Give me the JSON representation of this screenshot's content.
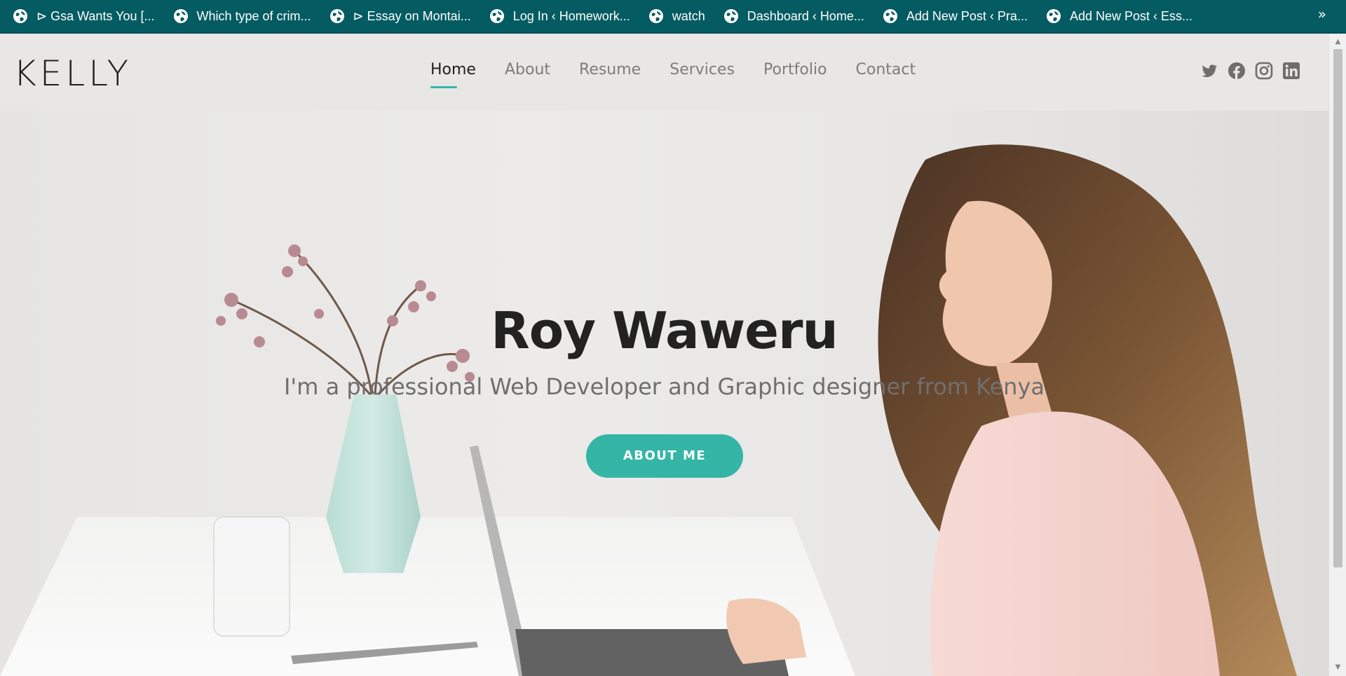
{
  "bookmarks": {
    "items": [
      {
        "label": "⊳ Gsa Wants You [..."
      },
      {
        "label": "Which type of crim..."
      },
      {
        "label": "⊳ Essay on Montai..."
      },
      {
        "label": "Log In ‹ Homework..."
      },
      {
        "label": "watch"
      },
      {
        "label": "Dashboard ‹ Home..."
      },
      {
        "label": "Add New Post ‹ Pra..."
      },
      {
        "label": "Add New Post ‹ Ess..."
      }
    ],
    "overflow": "»",
    "icon": "globe-icon"
  },
  "header": {
    "logo": "KELLY",
    "nav": [
      {
        "label": "Home",
        "active": true
      },
      {
        "label": "About"
      },
      {
        "label": "Resume"
      },
      {
        "label": "Services"
      },
      {
        "label": "Portfolio"
      },
      {
        "label": "Contact"
      }
    ],
    "social": [
      "twitter-icon",
      "facebook-icon",
      "instagram-icon",
      "linkedin-icon"
    ]
  },
  "hero": {
    "title": "Roy Waweru",
    "subtitle": "I'm a professional Web Developer and Graphic designer from Kenya",
    "button": "ABOUT ME"
  },
  "colors": {
    "bookmark_bar": "#045c62",
    "accent": "#35b5a5",
    "header_bg": "#e8e7e5",
    "title": "#222222"
  }
}
